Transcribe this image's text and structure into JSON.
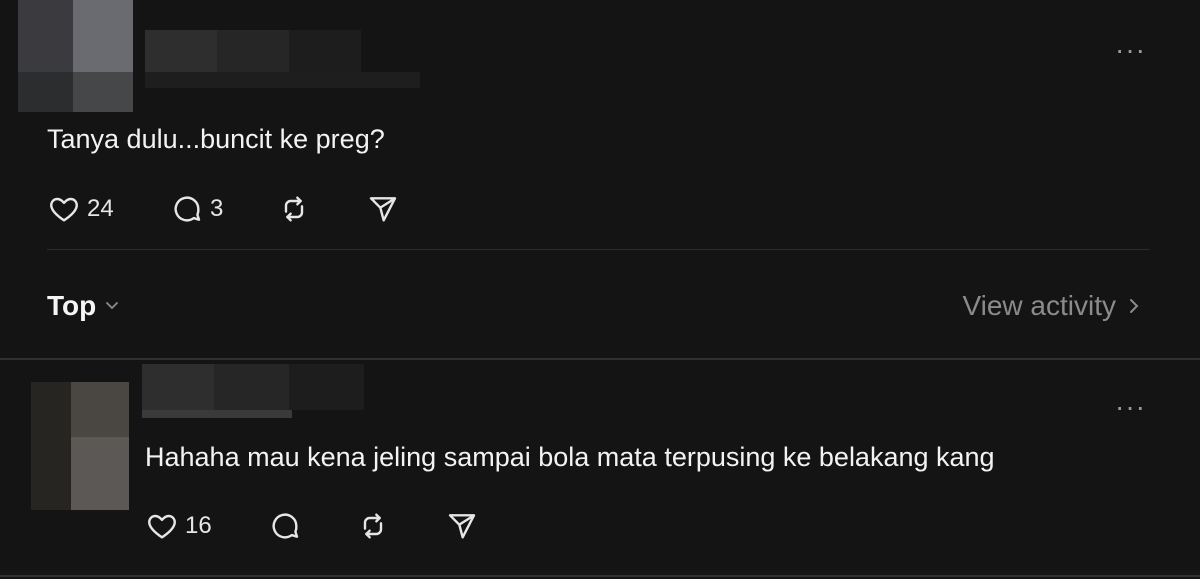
{
  "post": {
    "text": "Tanya dulu...buncit ke preg?",
    "likes": "24",
    "replies": "3",
    "more_icon": "more-horizontal-icon"
  },
  "sort": {
    "label": "Top",
    "view_activity": "View activity"
  },
  "reply": {
    "text": "Hahaha mau kena jeling sampai bola mata terpusing ke belakang kang",
    "likes": "16"
  },
  "colors": {
    "background": "#141414",
    "text": "#f3f3f3",
    "muted": "#8b8b8b",
    "divider": "#2c2c2c"
  }
}
